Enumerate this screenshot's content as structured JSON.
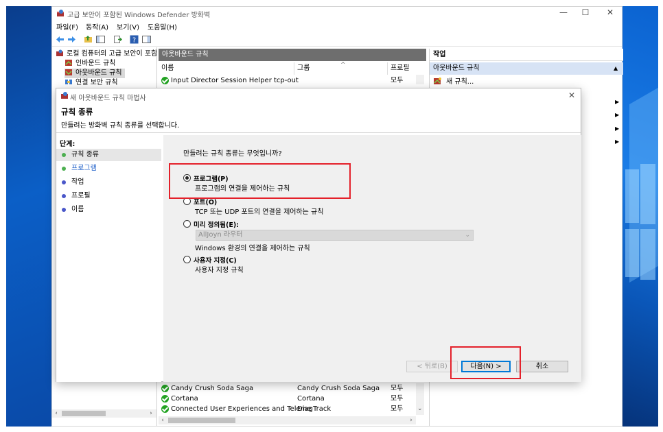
{
  "window": {
    "title": "고급 보안이 포함된 Windows Defender 방화벽",
    "controls": {
      "minimize": "—",
      "maximize": "☐",
      "close": "✕"
    }
  },
  "menu": [
    "파일(F)",
    "동작(A)",
    "보기(V)",
    "도움말(H)"
  ],
  "tree": {
    "root": "로컬 컴퓨터의 고급 보안이 포함",
    "items": [
      "인바운드 규칙",
      "아웃바운드 규칙",
      "연결 보안 규칙"
    ]
  },
  "list": {
    "header": "아웃바운드 규칙",
    "columns": [
      "이름",
      "그룹",
      "프로필"
    ],
    "top_rows": [
      {
        "name": "Input Director Session Helper tcp-out",
        "group": "",
        "profile": "모두"
      }
    ],
    "bottom_rows": [
      {
        "name": "Candy Crush Soda Saga",
        "group": "Candy Crush Soda Saga",
        "profile": "모두"
      },
      {
        "name": "Cortana",
        "group": "Cortana",
        "profile": "모두"
      },
      {
        "name": "Connected User Experiences and Teleme",
        "group": "DiagTrack",
        "profile": "모두"
      }
    ]
  },
  "actions": {
    "header": "작업",
    "section": "아웃바운드 규칙",
    "new_rule": "새 규칙..."
  },
  "dialog": {
    "title": "새 아웃바운드 규칙 마법사",
    "heading": "규칙 종류",
    "subheading": "만들려는 방화벽 규칙 종류를 선택합니다.",
    "steps_title": "단계:",
    "steps": [
      {
        "label": "규칙 종류",
        "color": "#4caf50",
        "active": true
      },
      {
        "label": "프로그램",
        "color": "#4caf50",
        "active": false
      },
      {
        "label": "작업",
        "color": "#4a57c9",
        "active": false
      },
      {
        "label": "프로필",
        "color": "#4a57c9",
        "active": false
      },
      {
        "label": "이름",
        "color": "#4a57c9",
        "active": false
      }
    ],
    "question": "만들려는 규칙 종류는 무엇입니까?",
    "options": [
      {
        "label": "프로그램(P)",
        "desc": "프로그램의 연결을 제어하는 규칙",
        "selected": true
      },
      {
        "label": "포트(O)",
        "desc": "TCP 또는 UDP 포트의 연결을 제어하는 규칙",
        "selected": false
      },
      {
        "label": "미리 정의됨(E):",
        "desc": "Windows 환경의 연결을 제어하는 규칙",
        "selected": false
      },
      {
        "label": "사용자 지정(C)",
        "desc": "사용자 지정 규칙",
        "selected": false
      }
    ],
    "predefined_value": "AllJoyn 라우터",
    "buttons": {
      "back": "< 뒤로(B)",
      "next": "다음(N) >",
      "cancel": "취소"
    }
  },
  "colors": {
    "highlight": "#e4202a",
    "panel_header": "#6e6e6e",
    "selection": "#d7e3f5"
  }
}
